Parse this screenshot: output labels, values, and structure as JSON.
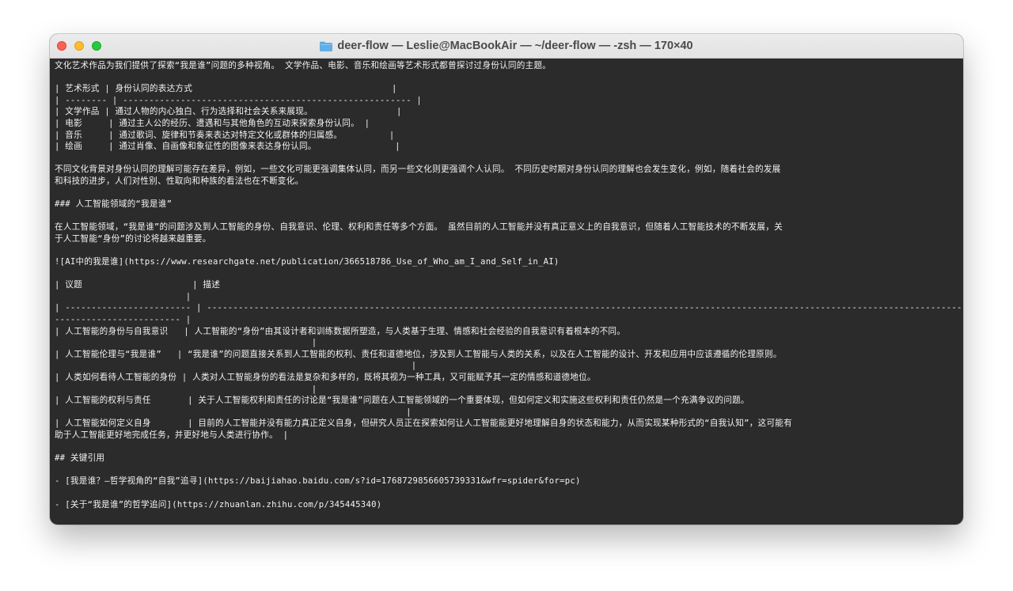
{
  "window": {
    "title": "deer-flow — Leslie@MacBookAir — ~/deer-flow — -zsh — 170×40",
    "title_icon": "folder-icon"
  },
  "terminal": {
    "lines": [
      "文化艺术作品为我们提供了探索“我是谁”问题的多种视角。 文学作品、电影、音乐和绘画等艺术形式都曾探讨过身份认同的主题。",
      "",
      "| 艺术形式 | 身份认同的表达方式                                      |",
      "| -------- | ------------------------------------------------------- |",
      "| 文学作品 | 通过人物的内心独白、行为选择和社会关系来展现。                |",
      "| 电影     | 通过主人公的经历、遭遇和与其他角色的互动来探索身份认同。 |",
      "| 音乐     | 通过歌词、旋律和节奏来表达对特定文化或群体的归属感。         |",
      "| 绘画     | 通过肖像、自画像和象征性的图像来表达身份认同。               |",
      "",
      "不同文化背景对身份认同的理解可能存在差异，例如，一些文化可能更强调集体认同，而另一些文化则更强调个人认同。 不同历史时期对身份认同的理解也会发生变化，例如，随着社会的发展",
      "和科技的进步，人们对性别、性取向和种族的看法也在不断变化。",
      "",
      "### 人工智能领域的“我是谁”",
      "",
      "在人工智能领域，“我是谁”的问题涉及到人工智能的身份、自我意识、伦理、权利和责任等多个方面。 虽然目前的人工智能并没有真正意义上的自我意识，但随着人工智能技术的不断发展，关",
      "于人工智能“身份”的讨论将越来越重要。",
      "",
      "![AI中的我是谁](https://www.researchgate.net/publication/366518786_Use_of_Who_am_I_and_Self_in_AI)",
      "",
      "| 议题                     | 描述",
      "                         |",
      "| ------------------------ | --------------------------------------------------------------------------------------------------------------------------------------------------",
      "------------------------ |",
      "| 人工智能的身份与自我意识   | 人工智能的“身份”由其设计者和训练数据所塑造，与人类基于生理、情感和社会经验的自我意识有着根本的不同。",
      "                                                 |",
      "| 人工智能伦理与“我是谁”   | “我是谁”的问题直接关系到人工智能的权利、责任和道德地位，涉及到人工智能与人类的关系，以及在人工智能的设计、开发和应用中应该遵循的伦理原则。",
      "                                                                    |",
      "| 人类如何看待人工智能的身份 | 人类对人工智能身份的看法是复杂和多样的，既将其视为一种工具，又可能赋予其一定的情感和道德地位。",
      "                                                 |",
      "| 人工智能的权利与责任       | 关于人工智能权利和责任的讨论是“我是谁”问题在人工智能领域的一个重要体现，但如何定义和实施这些权利和责任仍然是一个充满争议的问题。",
      "                                                                   |",
      "| 人工智能如何定义自身       | 目前的人工智能并没有能力真正定义自身，但研究人员正在探索如何让人工智能能更好地理解自身的状态和能力，从而实现某种形式的“自我认知”，这可能有",
      "助于人工智能更好地完成任务，并更好地与人类进行协作。 |",
      "",
      "## 关键引用",
      "",
      "- [我是谁？—哲学视角的“自我”追寻](https://baijiahao.baidu.com/s?id=1768729856605739331&wfr=spider&for=pc)",
      "",
      "- [关于“我是谁”的哲学追问](https://zhuanlan.zhihu.com/p/345445340)"
    ]
  }
}
